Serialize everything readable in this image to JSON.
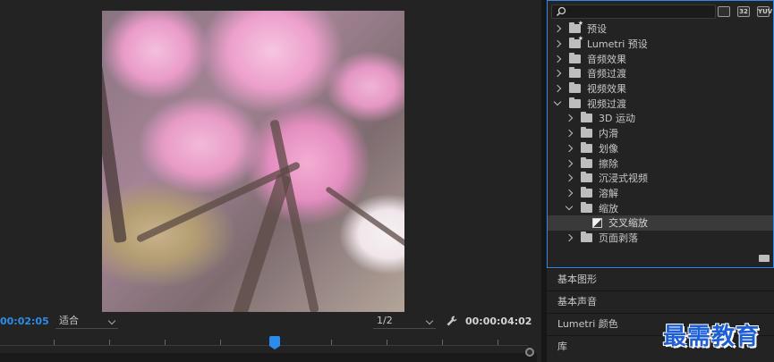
{
  "monitor": {
    "timecode_current": "00:02:05",
    "fit_label": "适合",
    "resolution_label": "1/2",
    "timecode_duration": "00:00:04:02"
  },
  "effects_panel": {
    "search_placeholder": "",
    "toolbar_icons": [
      "accelerated-effects-icon",
      "32-bit-icon",
      "yuv-icon"
    ],
    "toolbar_labels": [
      "",
      "32",
      "YUV"
    ],
    "tree": [
      {
        "label": "预设",
        "depth": 0,
        "expanded": false,
        "icon": "folder-star-icon"
      },
      {
        "label": "Lumetri 预设",
        "depth": 0,
        "expanded": false,
        "icon": "folder-star-icon"
      },
      {
        "label": "音频效果",
        "depth": 0,
        "expanded": false,
        "icon": "folder-icon"
      },
      {
        "label": "音频过渡",
        "depth": 0,
        "expanded": false,
        "icon": "folder-icon"
      },
      {
        "label": "视频效果",
        "depth": 0,
        "expanded": false,
        "icon": "folder-icon"
      },
      {
        "label": "视频过渡",
        "depth": 0,
        "expanded": true,
        "icon": "folder-icon"
      },
      {
        "label": "3D 运动",
        "depth": 1,
        "expanded": false,
        "icon": "folder-icon"
      },
      {
        "label": "内滑",
        "depth": 1,
        "expanded": false,
        "icon": "folder-icon"
      },
      {
        "label": "划像",
        "depth": 1,
        "expanded": false,
        "icon": "folder-icon"
      },
      {
        "label": "擦除",
        "depth": 1,
        "expanded": false,
        "icon": "folder-icon"
      },
      {
        "label": "沉浸式视频",
        "depth": 1,
        "expanded": false,
        "icon": "folder-icon"
      },
      {
        "label": "溶解",
        "depth": 1,
        "expanded": false,
        "icon": "folder-icon"
      },
      {
        "label": "缩放",
        "depth": 1,
        "expanded": true,
        "icon": "folder-icon"
      },
      {
        "label": "交叉缩放",
        "depth": 2,
        "expanded": false,
        "icon": "transition-icon",
        "selected": true
      },
      {
        "label": "页面剥落",
        "depth": 1,
        "expanded": false,
        "icon": "folder-icon"
      }
    ]
  },
  "panels": {
    "essential_graphics": "基本图形",
    "essential_sound": "基本声音",
    "lumetri_color": "Lumetri 颜色",
    "libraries": "库"
  },
  "watermark": "最需教育"
}
